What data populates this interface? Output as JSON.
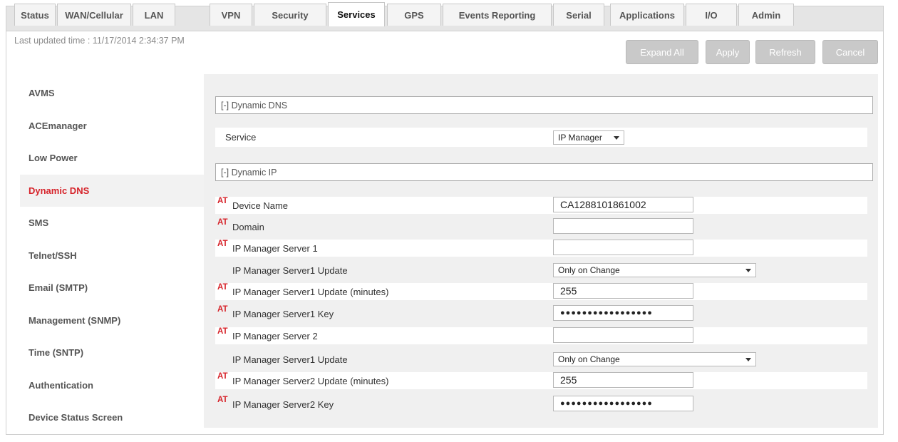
{
  "tabs": [
    {
      "label": "Status",
      "active": false
    },
    {
      "label": "WAN/Cellular",
      "active": false
    },
    {
      "label": "LAN",
      "active": false
    },
    {
      "label": "VPN",
      "active": false
    },
    {
      "label": "Security",
      "active": false
    },
    {
      "label": "Services",
      "active": true
    },
    {
      "label": "GPS",
      "active": false
    },
    {
      "label": "Events Reporting",
      "active": false
    },
    {
      "label": "Serial",
      "active": false
    },
    {
      "label": "Applications",
      "active": false
    },
    {
      "label": "I/O",
      "active": false
    },
    {
      "label": "Admin",
      "active": false
    }
  ],
  "header": {
    "last_updated": "Last updated time : 11/17/2014 2:34:37 PM",
    "buttons": {
      "expand_all": "Expand All",
      "apply": "Apply",
      "refresh": "Refresh",
      "cancel": "Cancel"
    }
  },
  "sidebar": {
    "items": [
      {
        "label": "AVMS",
        "active": false
      },
      {
        "label": "ACEmanager",
        "active": false
      },
      {
        "label": "Low Power",
        "active": false
      },
      {
        "label": "Dynamic DNS",
        "active": true
      },
      {
        "label": "SMS",
        "active": false
      },
      {
        "label": "Telnet/SSH",
        "active": false
      },
      {
        "label": "Email (SMTP)",
        "active": false
      },
      {
        "label": "Management (SNMP)",
        "active": false
      },
      {
        "label": "Time (SNTP)",
        "active": false
      },
      {
        "label": "Authentication",
        "active": false
      },
      {
        "label": "Device Status Screen",
        "active": false
      }
    ]
  },
  "colors": {
    "accent": "#d6232a",
    "button_bg": "#c9c9c9",
    "panel_bg": "#f0f0f0"
  },
  "at_marker": "AT",
  "dynamic_dns": {
    "header": "[-] Dynamic DNS",
    "service_label": "Service",
    "service_value": "IP Manager"
  },
  "dynamic_ip": {
    "header": "[-] Dynamic IP",
    "rows": [
      {
        "label": "Device Name",
        "value": "CA1288101861002"
      },
      {
        "label": "Domain",
        "value": ""
      },
      {
        "label": "IP Manager Server 1",
        "value": ""
      },
      {
        "label": "IP Manager Server1 Update",
        "value": "Only on Change"
      },
      {
        "label": "IP Manager Server1 Update (minutes)",
        "value": "255"
      },
      {
        "label": "IP Manager Server1 Key",
        "value": "●●●●●●●●●●●●●●●●●"
      },
      {
        "label": "IP Manager Server 2",
        "value": ""
      },
      {
        "label": "IP Manager Server1 Update",
        "value": "Only on Change"
      },
      {
        "label": "IP Manager Server2 Update (minutes)",
        "value": "255"
      },
      {
        "label": "IP Manager Server2 Key",
        "value": "●●●●●●●●●●●●●●●●●"
      }
    ]
  }
}
